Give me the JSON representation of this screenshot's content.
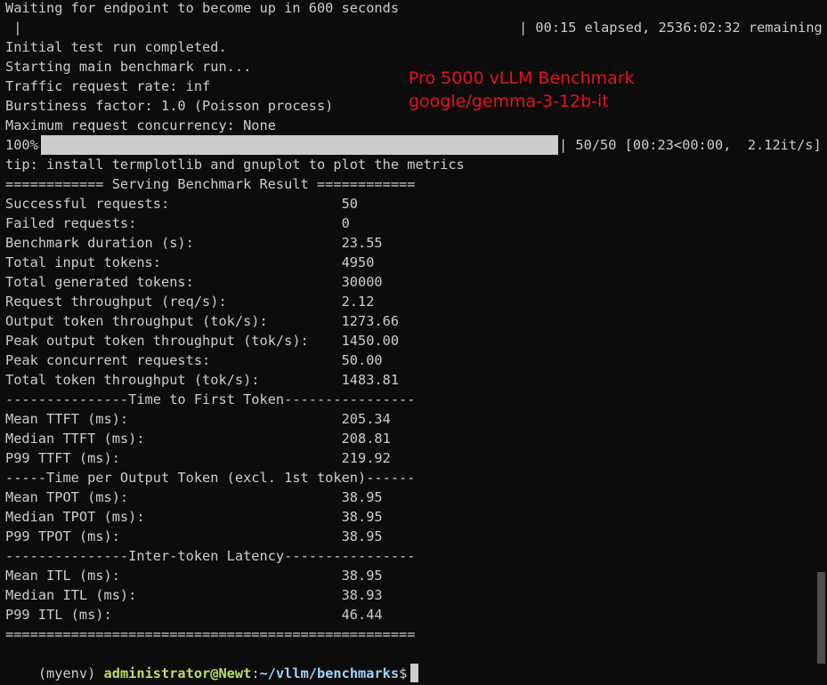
{
  "colors": {
    "background": "#0c0c0c",
    "text": "#cccccc",
    "overlay": "#e81123",
    "prompt_user": "#bddc6a",
    "prompt_path": "#9fd3f5"
  },
  "lines": [
    "Waiting for endpoint to become up in 600 seconds",
    " |",
    "Initial test run completed.",
    "Starting main benchmark run...",
    "Traffic request rate: inf",
    "Burstiness factor: 1.0 (Poisson process)",
    "Maximum request concurrency: None",
    "100%|",
    "tip: install termplotlib and gnuplot to plot the metrics",
    "============ Serving Benchmark Result ============",
    "Successful requests:                     50",
    "Failed requests:                         0",
    "Benchmark duration (s):                  23.55",
    "Total input tokens:                      4950",
    "Total generated tokens:                  30000",
    "Request throughput (req/s):              2.12",
    "Output token throughput (tok/s):         1273.66",
    "Peak output token throughput (tok/s):    1450.00",
    "Peak concurrent requests:                50.00",
    "Total token throughput (tok/s):          1483.81",
    "---------------Time to First Token----------------",
    "Mean TTFT (ms):                          205.34",
    "Median TTFT (ms):                        208.81",
    "P99 TTFT (ms):                           219.92",
    "-----Time per Output Token (excl. 1st token)------",
    "Mean TPOT (ms):                          38.95",
    "Median TPOT (ms):                        38.95",
    "P99 TPOT (ms):                           38.95",
    "---------------Inter-token Latency----------------",
    "Mean ITL (ms):                           38.95",
    "Median ITL (ms):                         38.93",
    "P99 ITL (ms):                            46.44",
    "=================================================="
  ],
  "status_line_1": "| 00:15 elapsed, 2536:02:32 remaining",
  "progress": {
    "percent": 100,
    "label": "| 50/50 [00:23<00:00,  2.12it/s]"
  },
  "overlay": {
    "title": "Pro 5000 vLLM Benchmark",
    "model": "google/gemma-3-12b-it"
  },
  "prompt": {
    "env": "(myenv) ",
    "user": "administrator@Newt",
    "sep": ":",
    "path": "~/vllm/benchmarks",
    "symbol": "$"
  }
}
